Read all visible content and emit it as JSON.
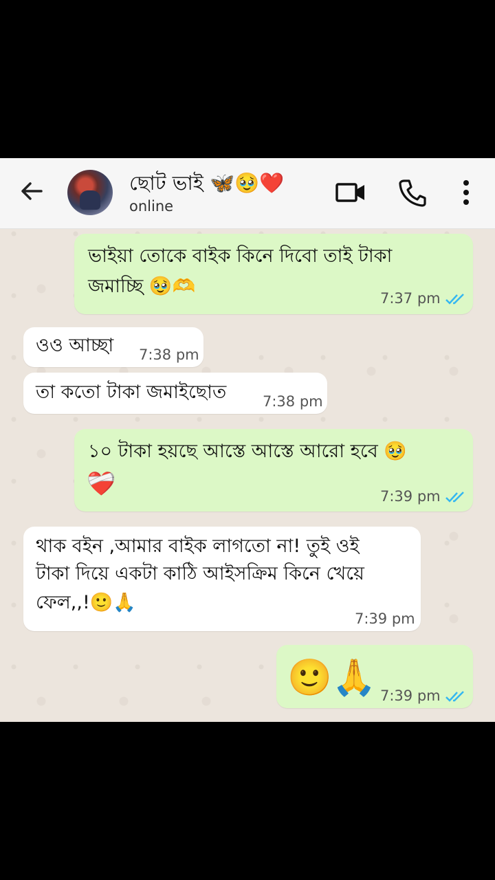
{
  "header": {
    "contact_name": "ছোট ভাই 🦋🥹❤️",
    "status": "online",
    "icons": [
      "back-arrow-icon",
      "avatar",
      "video-call-icon",
      "phone-call-icon",
      "more-vert-icon"
    ]
  },
  "messages": [
    {
      "direction": "out",
      "text_line1": "ভাইয়া তোকে বাইক কিনে দিবো তাই টাকা",
      "text_line2": "জমাচ্ছি 🥹🫶",
      "time": "7:37 pm",
      "status": "read"
    },
    {
      "direction": "in",
      "text": "ওও আচ্ছা",
      "time": "7:38 pm"
    },
    {
      "direction": "in",
      "text": "তা কতো টাকা জমাইছোত",
      "time": "7:38 pm"
    },
    {
      "direction": "out",
      "text_line1": "১০ টাকা হয়ছে আস্তে আস্তে আরো হবে 🥹",
      "text_line2": "❤️‍🩹",
      "time": "7:39 pm",
      "status": "read"
    },
    {
      "direction": "in",
      "text_line1": "থাক বইন ,আমার বাইক লাগতো না! তুই ওই",
      "text_line2": "টাকা দিয়ে একটা কাঠি আইসক্রিম কিনে খেয়ে",
      "text_line3": "ফেল,,!🙂🙏",
      "time": "7:39 pm"
    },
    {
      "direction": "out",
      "text": "🙂🙏",
      "time": "7:39 pm",
      "status": "read"
    }
  ],
  "colors": {
    "outgoing_bubble": "#dcf8c6",
    "incoming_bubble": "#ffffff",
    "read_ticks": "#34b7f1",
    "header_bg": "#f6f6f6"
  }
}
